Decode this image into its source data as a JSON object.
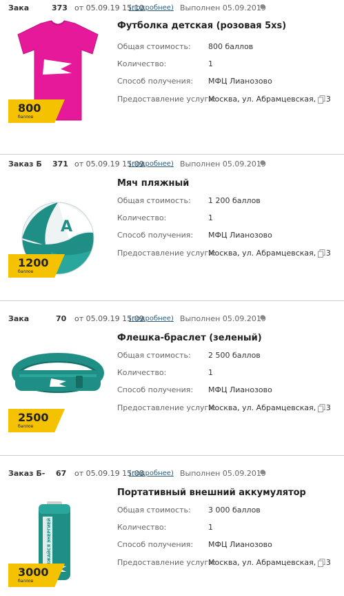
{
  "labels": {
    "cost": "Общая стоимость:",
    "qty": "Количество:",
    "delivery": "Способ получения:",
    "service": "Предоставление услуги:",
    "more": "подробнее",
    "points_unit": "баллов"
  },
  "orders": [
    {
      "order_label": "Зака",
      "order_num": "373",
      "datetime": "от 05.09.19 15:10",
      "status": "Выполнен 05.09.2019",
      "title": "Футболка детская (розовая 5xs)",
      "cost": "800 баллов",
      "qty": "1",
      "delivery": "МФЦ Лианозово",
      "service": "Москва, ул. Абрамцевская, д.3",
      "points": "800",
      "image": "pink-tshirt-image"
    },
    {
      "order_label": "Заказ Б",
      "order_num": "371",
      "datetime": "от 05.09.19 15:09",
      "status": "Выполнен 05.09.2019",
      "title": "Мяч пляжный",
      "cost": "1 200 баллов",
      "qty": "1",
      "delivery": "МФЦ Лианозово",
      "service": "Москва, ул. Абрамцевская, д.3",
      "points": "1200",
      "image": "beach-ball-image"
    },
    {
      "order_label": "Зака",
      "order_num": "70",
      "datetime": "от 05.09.19 15:09",
      "status": "Выполнен 05.09.2019",
      "title": "Флешка-браслет (зеленый)",
      "cost": "2 500 баллов",
      "qty": "1",
      "delivery": "МФЦ Лианозово",
      "service": "Москва, ул. Абрамцевская, д.3",
      "points": "2500",
      "image": "usb-bracelet-image"
    },
    {
      "order_label": "Заказ Б-",
      "order_num": "67",
      "datetime": "от 05.09.19 15:08",
      "status": "Выполнен 05.09.2019",
      "title": "Портативный внешний аккумулятор",
      "cost": "3 000 баллов",
      "qty": "1",
      "delivery": "МФЦ Лианозово",
      "service": "Москва, ул. Абрамцевская, д.3",
      "points": "3000",
      "image": "power-bank-image",
      "battery_text": "ЗАРЯЖАЙСЯ ЭНЕРГИЕЙ"
    }
  ],
  "colors": {
    "badge": "#f5c200",
    "tshirt": "#e6199b",
    "teal": "#1f8f86",
    "link": "#2a5d7a"
  }
}
